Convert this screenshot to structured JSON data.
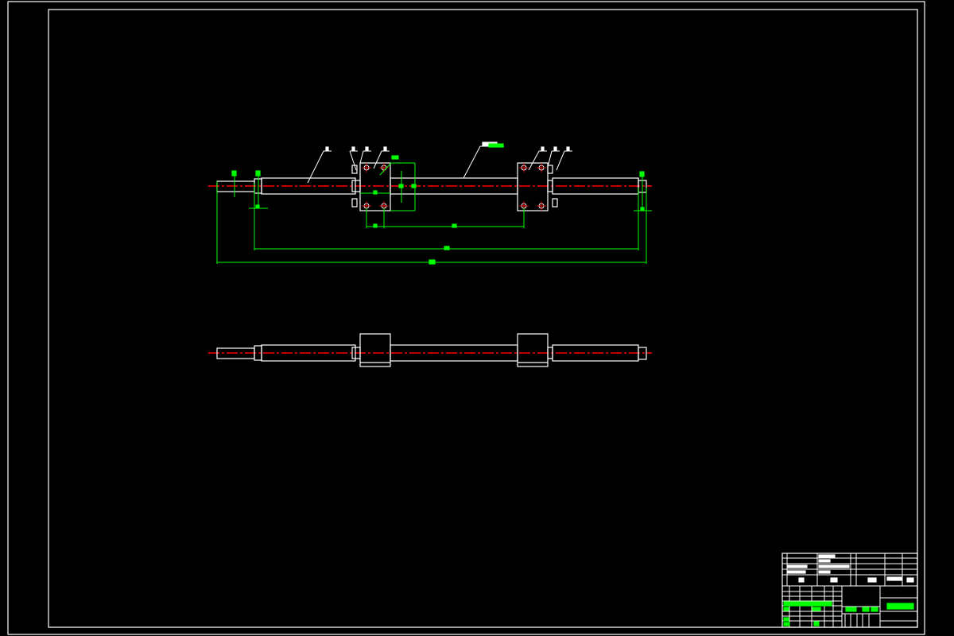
{
  "drawing": {
    "background": "#000000",
    "outline_color": "#ffffff",
    "dimension_color": "#00ff00",
    "centerline_color": "#ff0000"
  },
  "views": [
    "front-view",
    "top-view"
  ],
  "title_block": {}
}
